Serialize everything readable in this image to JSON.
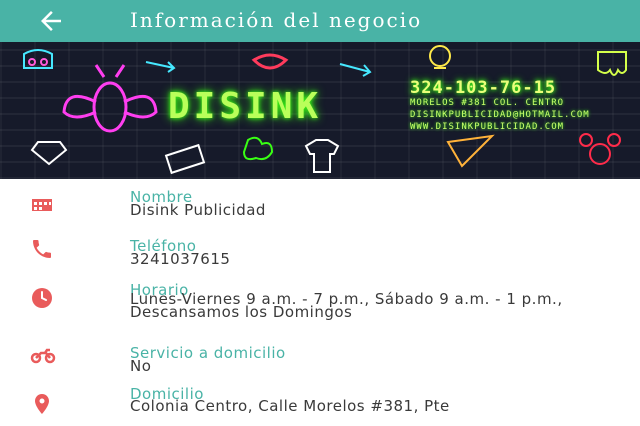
{
  "appbar": {
    "title": "Información del negocio",
    "back_icon": "arrow-back-icon"
  },
  "banner": {
    "logo_text": "DISINK",
    "phone_text": "324-103-76-15",
    "address_text": "MORELOS #381 COL. CENTRO",
    "email_text": "DISINKPUBLICIDAD@HOTMAIL.COM",
    "web_text": "WWW.DISINKPUBLICIDAD.COM"
  },
  "colors": {
    "accent": "#49b3a6",
    "icon": "#e95b5b",
    "text": "#3a3a3a"
  },
  "fields": [
    {
      "label": "Nombre",
      "value": "Disink Publicidad",
      "icon": "store-icon"
    },
    {
      "label": "Teléfono",
      "value": "3241037615",
      "icon": "phone-icon"
    },
    {
      "label": "Horario",
      "value": "Lunes-Viernes 9 a.m. - 7 p.m., Sábado 9 a.m. - 1 p.m.,  Descansamos los Domingos",
      "icon": "clock-icon"
    },
    {
      "label": "Servicio a domicilio",
      "value": "No",
      "icon": "motorcycle-icon"
    },
    {
      "label": "Domicilio",
      "value": "Colonia Centro, Calle Morelos #381, Pte",
      "icon": "location-pin-icon"
    }
  ]
}
